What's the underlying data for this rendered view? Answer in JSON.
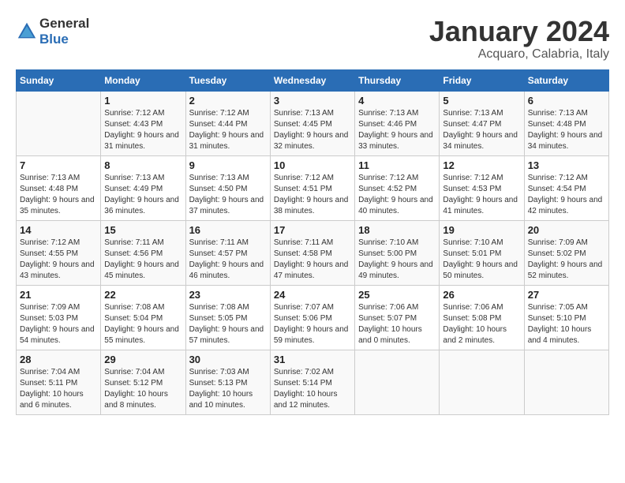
{
  "header": {
    "logo_line1": "General",
    "logo_line2": "Blue",
    "month": "January 2024",
    "location": "Acquaro, Calabria, Italy"
  },
  "weekdays": [
    "Sunday",
    "Monday",
    "Tuesday",
    "Wednesday",
    "Thursday",
    "Friday",
    "Saturday"
  ],
  "weeks": [
    [
      {
        "day": "",
        "sunrise": "",
        "sunset": "",
        "daylight": ""
      },
      {
        "day": "1",
        "sunrise": "7:12 AM",
        "sunset": "4:43 PM",
        "daylight": "9 hours and 31 minutes."
      },
      {
        "day": "2",
        "sunrise": "7:12 AM",
        "sunset": "4:44 PM",
        "daylight": "9 hours and 31 minutes."
      },
      {
        "day": "3",
        "sunrise": "7:13 AM",
        "sunset": "4:45 PM",
        "daylight": "9 hours and 32 minutes."
      },
      {
        "day": "4",
        "sunrise": "7:13 AM",
        "sunset": "4:46 PM",
        "daylight": "9 hours and 33 minutes."
      },
      {
        "day": "5",
        "sunrise": "7:13 AM",
        "sunset": "4:47 PM",
        "daylight": "9 hours and 34 minutes."
      },
      {
        "day": "6",
        "sunrise": "7:13 AM",
        "sunset": "4:48 PM",
        "daylight": "9 hours and 34 minutes."
      }
    ],
    [
      {
        "day": "7",
        "sunrise": "7:13 AM",
        "sunset": "4:48 PM",
        "daylight": "9 hours and 35 minutes."
      },
      {
        "day": "8",
        "sunrise": "7:13 AM",
        "sunset": "4:49 PM",
        "daylight": "9 hours and 36 minutes."
      },
      {
        "day": "9",
        "sunrise": "7:13 AM",
        "sunset": "4:50 PM",
        "daylight": "9 hours and 37 minutes."
      },
      {
        "day": "10",
        "sunrise": "7:12 AM",
        "sunset": "4:51 PM",
        "daylight": "9 hours and 38 minutes."
      },
      {
        "day": "11",
        "sunrise": "7:12 AM",
        "sunset": "4:52 PM",
        "daylight": "9 hours and 40 minutes."
      },
      {
        "day": "12",
        "sunrise": "7:12 AM",
        "sunset": "4:53 PM",
        "daylight": "9 hours and 41 minutes."
      },
      {
        "day": "13",
        "sunrise": "7:12 AM",
        "sunset": "4:54 PM",
        "daylight": "9 hours and 42 minutes."
      }
    ],
    [
      {
        "day": "14",
        "sunrise": "7:12 AM",
        "sunset": "4:55 PM",
        "daylight": "9 hours and 43 minutes."
      },
      {
        "day": "15",
        "sunrise": "7:11 AM",
        "sunset": "4:56 PM",
        "daylight": "9 hours and 45 minutes."
      },
      {
        "day": "16",
        "sunrise": "7:11 AM",
        "sunset": "4:57 PM",
        "daylight": "9 hours and 46 minutes."
      },
      {
        "day": "17",
        "sunrise": "7:11 AM",
        "sunset": "4:58 PM",
        "daylight": "9 hours and 47 minutes."
      },
      {
        "day": "18",
        "sunrise": "7:10 AM",
        "sunset": "5:00 PM",
        "daylight": "9 hours and 49 minutes."
      },
      {
        "day": "19",
        "sunrise": "7:10 AM",
        "sunset": "5:01 PM",
        "daylight": "9 hours and 50 minutes."
      },
      {
        "day": "20",
        "sunrise": "7:09 AM",
        "sunset": "5:02 PM",
        "daylight": "9 hours and 52 minutes."
      }
    ],
    [
      {
        "day": "21",
        "sunrise": "7:09 AM",
        "sunset": "5:03 PM",
        "daylight": "9 hours and 54 minutes."
      },
      {
        "day": "22",
        "sunrise": "7:08 AM",
        "sunset": "5:04 PM",
        "daylight": "9 hours and 55 minutes."
      },
      {
        "day": "23",
        "sunrise": "7:08 AM",
        "sunset": "5:05 PM",
        "daylight": "9 hours and 57 minutes."
      },
      {
        "day": "24",
        "sunrise": "7:07 AM",
        "sunset": "5:06 PM",
        "daylight": "9 hours and 59 minutes."
      },
      {
        "day": "25",
        "sunrise": "7:06 AM",
        "sunset": "5:07 PM",
        "daylight": "10 hours and 0 minutes."
      },
      {
        "day": "26",
        "sunrise": "7:06 AM",
        "sunset": "5:08 PM",
        "daylight": "10 hours and 2 minutes."
      },
      {
        "day": "27",
        "sunrise": "7:05 AM",
        "sunset": "5:10 PM",
        "daylight": "10 hours and 4 minutes."
      }
    ],
    [
      {
        "day": "28",
        "sunrise": "7:04 AM",
        "sunset": "5:11 PM",
        "daylight": "10 hours and 6 minutes."
      },
      {
        "day": "29",
        "sunrise": "7:04 AM",
        "sunset": "5:12 PM",
        "daylight": "10 hours and 8 minutes."
      },
      {
        "day": "30",
        "sunrise": "7:03 AM",
        "sunset": "5:13 PM",
        "daylight": "10 hours and 10 minutes."
      },
      {
        "day": "31",
        "sunrise": "7:02 AM",
        "sunset": "5:14 PM",
        "daylight": "10 hours and 12 minutes."
      },
      {
        "day": "",
        "sunrise": "",
        "sunset": "",
        "daylight": ""
      },
      {
        "day": "",
        "sunrise": "",
        "sunset": "",
        "daylight": ""
      },
      {
        "day": "",
        "sunrise": "",
        "sunset": "",
        "daylight": ""
      }
    ]
  ]
}
